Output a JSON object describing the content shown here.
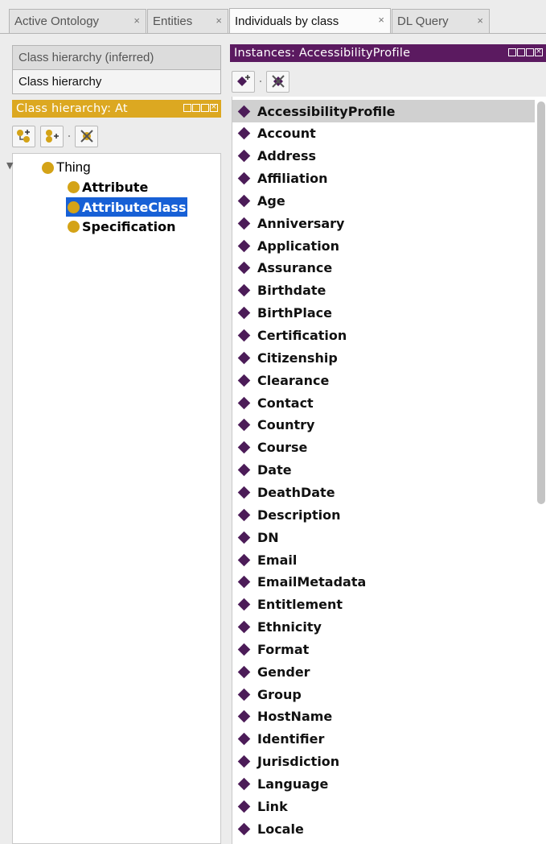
{
  "tabs": [
    {
      "label": "Active Ontology",
      "close": "×",
      "active": false
    },
    {
      "label": "Entities",
      "close": "×",
      "active": false
    },
    {
      "label": "Individuals by class",
      "close": "×",
      "active": true
    },
    {
      "label": "DL Query",
      "close": "×",
      "active": false
    }
  ],
  "left_panel": {
    "view_tabs": [
      "Class hierarchy (inferred)",
      "Class hierarchy"
    ],
    "header": "Class hierarchy: At",
    "tree": {
      "root": "Thing",
      "children": [
        "Attribute",
        "AttributeClass",
        "Specification"
      ],
      "selected": "AttributeClass"
    }
  },
  "right_panel": {
    "header": "Instances: AccessibilityProfile",
    "selected": "AccessibilityProfile",
    "instances": [
      "AccessibilityProfile",
      "Account",
      "Address",
      "Affiliation",
      "Age",
      "Anniversary",
      "Application",
      "Assurance",
      "Birthdate",
      "BirthPlace",
      "Certification",
      "Citizenship",
      "Clearance",
      "Contact",
      "Country",
      "Course",
      "Date",
      "DeathDate",
      "Description",
      "DN",
      "Email",
      "EmailMetadata",
      "Entitlement",
      "Ethnicity",
      "Format",
      "Gender",
      "Group",
      "HostName",
      "Identifier",
      "Jurisdiction",
      "Language",
      "Link",
      "Locale"
    ]
  },
  "colors": {
    "class_header": "#dca821",
    "instances_header": "#5b1a60",
    "class_dot": "#d4a317",
    "individual_diamond": "#4c1c58",
    "selection": "#1760d6"
  }
}
